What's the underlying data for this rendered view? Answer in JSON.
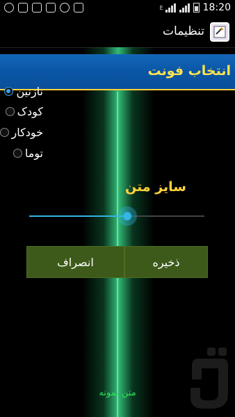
{
  "status_bar": {
    "time": "18:20",
    "network_label": "E",
    "left_icons": [
      "alert-icon",
      "close-box-icon",
      "image-icon",
      "image-icon",
      "sync-icon",
      "play-store-icon"
    ],
    "right_icons": [
      "signal-icon",
      "signal-icon",
      "battery-icon"
    ]
  },
  "action_bar": {
    "title": "تنظیمات",
    "icon": "app-logo-icon"
  },
  "font_section": {
    "title": "انتخاب فونت",
    "options": [
      {
        "label": "نازنین",
        "selected": true
      },
      {
        "label": "کودک",
        "selected": false
      },
      {
        "label": "خودکار",
        "selected": false
      },
      {
        "label": "توما",
        "selected": false
      }
    ]
  },
  "size_section": {
    "title": "سایز متن",
    "slider_fraction": 0.56
  },
  "buttons": {
    "save": "ذخیره",
    "cancel": "انصراف"
  },
  "sample_text": "متن نمونه",
  "colors": {
    "header_blue": "#0a56a6",
    "title_yellow": "#ffd23a",
    "button_green": "#3d5a1a",
    "accent_blue": "#33b5e5",
    "sample_green": "#2ee05a",
    "glow_green": "#3cdc8c"
  }
}
